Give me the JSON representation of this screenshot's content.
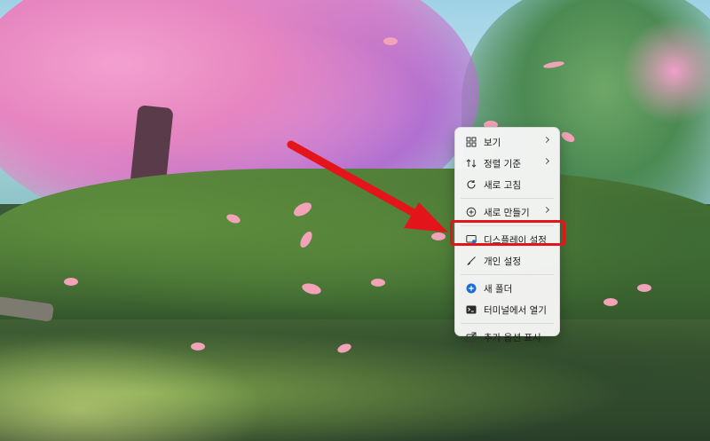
{
  "context_menu": {
    "items": [
      {
        "label": "보기",
        "icon": "grid-view-icon",
        "submenu": true
      },
      {
        "label": "정렬 기준",
        "icon": "sort-icon",
        "submenu": true
      },
      {
        "label": "새로 고침",
        "icon": "refresh-icon",
        "submenu": false
      },
      {
        "label": "새로 만들기",
        "icon": "new-plus-icon",
        "submenu": true
      },
      {
        "label": "디스플레이 설정",
        "icon": "display-settings-icon",
        "submenu": false
      },
      {
        "label": "개인 설정",
        "icon": "personalize-brush-icon",
        "submenu": false
      },
      {
        "label": "새 폴더",
        "icon": "new-folder-icon",
        "submenu": false
      },
      {
        "label": "터미널에서 열기",
        "icon": "terminal-icon",
        "submenu": false
      },
      {
        "label": "추가 옵션 표시",
        "icon": "more-options-icon",
        "submenu": false
      }
    ],
    "highlighted_item": "디스플레이 설정"
  },
  "annotation": {
    "arrow_color": "#e4141b",
    "highlight_color": "#e4141b"
  }
}
